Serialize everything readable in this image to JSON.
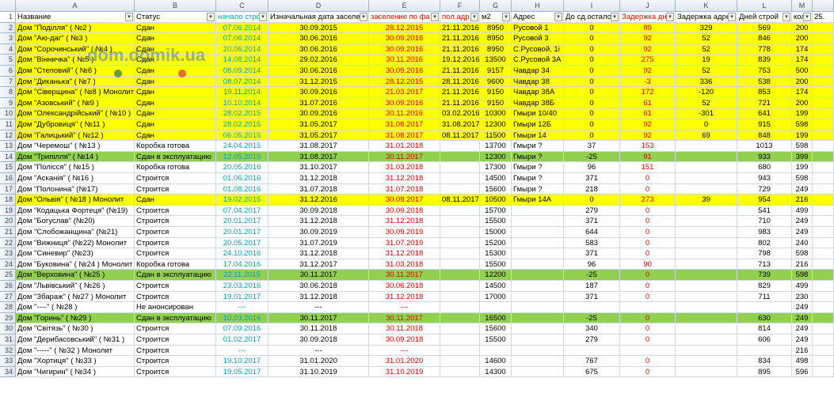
{
  "columns": [
    "A",
    "B",
    "C",
    "D",
    "E",
    "F",
    "G",
    "H",
    "I",
    "J",
    "K",
    "L",
    "M"
  ],
  "headers": {
    "rn": "1",
    "name": "Название",
    "status": "Статус",
    "start": "начало стро",
    "orig_date": "Изначальная дата заселе",
    "settle": "заселение по фа",
    "pol": "пол.адр",
    "m2": "м2",
    "addr": "Адрес",
    "left": "До сд.остало",
    "delay": "Задержка дн",
    "delay_addr": "Задержка адре",
    "days": "Дней строй",
    "kol": "кол",
    "extra": "25."
  },
  "watermark": "dom.domik.ua",
  "rows": [
    {
      "rn": "2",
      "name": "Дом \"Поділля\" ( №2 )",
      "status": "Сдан",
      "start": "07.06.2014",
      "orig": "30.09.2015",
      "settle": "28.12.2015",
      "pol": "21.11.2016",
      "m2": "8950",
      "addr": "Русовой 1",
      "left": "0",
      "delay": "89",
      "dadr": "329",
      "days": "569",
      "kol": "200",
      "style": "yellow"
    },
    {
      "rn": "3",
      "name": "Дом \"Аю-даг\" ( №3 )",
      "status": "Сдан",
      "start": "07.06.2014",
      "orig": "30.06.2016",
      "settle": "30.09.2016",
      "pol": "21.11.2016",
      "m2": "8950",
      "addr": "Русовой 3",
      "left": "0",
      "delay": "92",
      "dadr": "52",
      "days": "846",
      "kol": "200",
      "style": "yellow"
    },
    {
      "rn": "4",
      "name": "Дом \"Сорочинський\" ( №4 )",
      "status": "Сдан",
      "start": "20.06.2014",
      "orig": "30.06.2016",
      "settle": "30.09.2016",
      "pol": "21.11.2016",
      "m2": "8950",
      "addr": "С.Русовой, 1і",
      "left": "0",
      "delay": "92",
      "dadr": "52",
      "days": "778",
      "kol": "174",
      "style": "yellow"
    },
    {
      "rn": "5",
      "name": "Дом \"Вінничка\" ( №5 )",
      "status": "Сдан",
      "start": "14.08.2014",
      "orig": "29.02.2016",
      "settle": "30.11.2016",
      "pol": "19.12.2016",
      "m2": "13500",
      "addr": "С.Русовой 3А",
      "left": "0",
      "delay": "275",
      "dadr": "19",
      "days": "839",
      "kol": "174",
      "style": "yellow"
    },
    {
      "rn": "6",
      "name": "Дом \"Степовий\" ( №6 )",
      "status": "Сдан",
      "start": "08.09.2014",
      "orig": "30.06.2016",
      "settle": "30.09.2016",
      "pol": "21.11.2016",
      "m2": "9157",
      "addr": "Чавдар 34",
      "left": "0",
      "delay": "92",
      "dadr": "52",
      "days": "753",
      "kol": "500",
      "style": "yellow"
    },
    {
      "rn": "7",
      "name": "Дом \"Диканька\" ( №7 )",
      "status": "Сдан",
      "start": "08.07.2014",
      "orig": "31.12.2015",
      "settle": "28.12.2015",
      "pol": "28.11.2016",
      "m2": "9600",
      "addr": "Чавдар 38",
      "left": "0",
      "delay": "-3",
      "dadr": "336",
      "days": "538",
      "kol": "200",
      "style": "yellow"
    },
    {
      "rn": "8",
      "name": "Дом \"Сіверщина\" ( №8 ) Монолит",
      "status": "Сдан",
      "start": "19.11.2014",
      "orig": "30.09.2016",
      "settle": "21.03.2017",
      "pol": "21.11.2016",
      "m2": "9150",
      "addr": "Чавдар 38А",
      "left": "0",
      "delay": "172",
      "dadr": "-120",
      "days": "853",
      "kol": "174",
      "style": "yellow"
    },
    {
      "rn": "9",
      "name": "Дом \"Азовський\" ( №9 )",
      "status": "Сдан",
      "start": "10.10.2014",
      "orig": "31.07.2016",
      "settle": "30.09.2016",
      "pol": "21.11.2016",
      "m2": "9150",
      "addr": "Чавдар 38Б",
      "left": "0",
      "delay": "61",
      "dadr": "52",
      "days": "721",
      "kol": "200",
      "style": "yellow"
    },
    {
      "rn": "10",
      "name": "Дом \"Олександрійський\" ( №10 )",
      "status": "Сдан",
      "start": "28.02.2015",
      "orig": "30.09.2016",
      "settle": "30.11.2016",
      "pol": "03.02.2016",
      "m2": "10300",
      "addr": "Гмыри 10/40",
      "left": "0",
      "delay": "61",
      "dadr": "-301",
      "days": "641",
      "kol": "199",
      "style": "yellow"
    },
    {
      "rn": "11",
      "name": "Дом \"Дубровиця\" ( №11 )",
      "status": "Сдан",
      "start": "28.02.2015",
      "orig": "31.05.2017",
      "settle": "31.08.2017",
      "pol": "31.08.2017",
      "m2": "12300",
      "addr": "Гмыри 12Б",
      "left": "0",
      "delay": "92",
      "dadr": "0",
      "days": "915",
      "kol": "598",
      "style": "yellow"
    },
    {
      "rn": "12",
      "name": "Дом \"Галицький\" ( №12 )",
      "status": "Сдан",
      "start": "06.05.2015",
      "orig": "31.05.2017",
      "settle": "31.08.2017",
      "pol": "08.11.2017",
      "m2": "11500",
      "addr": "Гмыри 14",
      "left": "0",
      "delay": "92",
      "dadr": "69",
      "days": "848",
      "kol": "199",
      "style": "yellow"
    },
    {
      "rn": "13",
      "name": "Дом \"Черемош\" ( №13 )",
      "status": "Коробка готова",
      "start": "24.04.2015",
      "orig": "31.08.2017",
      "settle": "31.01.2018",
      "pol": "",
      "m2": "13700",
      "addr": "Гмыри ?",
      "left": "37",
      "delay": "153",
      "dadr": "",
      "days": "1013",
      "kol": "598",
      "style": ""
    },
    {
      "rn": "14",
      "name": "Дом \"Трипілля\" ( №14 )",
      "status": "Сдан в эксплуатацию",
      "start": "12.05.2015",
      "orig": "31.08.2017",
      "settle": "30.11.2017",
      "pol": "",
      "m2": "12300",
      "addr": "Гмыри ?",
      "left": "-25",
      "delay": "91",
      "dadr": "",
      "days": "933",
      "kol": "399",
      "style": "green"
    },
    {
      "rn": "15",
      "name": "Дом \"Полісся\" ( №15 )",
      "status": "Коробка готова",
      "start": "20.05.2016",
      "orig": "31.10.2017",
      "settle": "31.03.2018",
      "pol": "",
      "m2": "17300",
      "addr": "Гмыри ?",
      "left": "96",
      "delay": "151",
      "dadr": "",
      "days": "680",
      "kol": "199",
      "style": ""
    },
    {
      "rn": "16",
      "name": "Дом \"Асканія\" ( №16 )",
      "status": "Строится",
      "start": "01.06.2016",
      "orig": "31.12.2018",
      "settle": "31.12.2018",
      "pol": "",
      "m2": "14500",
      "addr": "Гмыри ?",
      "left": "371",
      "delay": "0",
      "dadr": "",
      "days": "943",
      "kol": "598",
      "style": ""
    },
    {
      "rn": "17",
      "name": "Дом \"Полонина\" (№17)",
      "status": "Строится",
      "start": "01.08.2016",
      "orig": "31.07.2018",
      "settle": "31.07.2018",
      "pol": "",
      "m2": "15600",
      "addr": "Гмыри ?",
      "left": "218",
      "delay": "0",
      "dadr": "",
      "days": "729",
      "kol": "249",
      "style": ""
    },
    {
      "rn": "18",
      "name": "Дом \"Ольвія\" ( №18 ) Монолит",
      "status": "Сдан",
      "start": "19.02.2015",
      "orig": "31.12.2016",
      "settle": "30.09.2017",
      "pol": "08.11.2017",
      "m2": "10500",
      "addr": "Гмыри 14А",
      "left": "0",
      "delay": "273",
      "dadr": "39",
      "days": "954",
      "kol": "216",
      "style": "yellow"
    },
    {
      "rn": "19",
      "name": "Дом \"Кодацька Фортеця\" (№19)",
      "status": "Строится",
      "start": "07.04.2017",
      "orig": "30.09.2018",
      "settle": "30.09.2018",
      "pol": "",
      "m2": "15700",
      "addr": "",
      "left": "279",
      "delay": "0",
      "dadr": "",
      "days": "541",
      "kol": "499",
      "style": ""
    },
    {
      "rn": "20",
      "name": "Дом \"Богуслав\" (№20)",
      "status": "Строится",
      "start": "20.01.2017",
      "orig": "31.12.2018",
      "settle": "31.12.2018",
      "pol": "",
      "m2": "15500",
      "addr": "",
      "left": "371",
      "delay": "0",
      "dadr": "",
      "days": "710",
      "kol": "249",
      "style": ""
    },
    {
      "rn": "21",
      "name": "Дом \"Слобожанщина\" (№21)",
      "status": "Строится",
      "start": "20.01.2017",
      "orig": "30.09.2019",
      "settle": "30.09.2019",
      "pol": "",
      "m2": "15000",
      "addr": "",
      "left": "644",
      "delay": "0",
      "dadr": "",
      "days": "983",
      "kol": "249",
      "style": ""
    },
    {
      "rn": "22",
      "name": "Дом \"Вижниця\" (№22) Монолит",
      "status": "Строится",
      "start": "20.05.2017",
      "orig": "31.07.2019",
      "settle": "31.07.2019",
      "pol": "",
      "m2": "15200",
      "addr": "",
      "left": "583",
      "delay": "0",
      "dadr": "",
      "days": "802",
      "kol": "240",
      "style": ""
    },
    {
      "rn": "23",
      "name": "Дом \"Синевир\" (№23)",
      "status": "Строится",
      "start": "24.10.2016",
      "orig": "31.12.2018",
      "settle": "31.12.2018",
      "pol": "",
      "m2": "15300",
      "addr": "",
      "left": "371",
      "delay": "0",
      "dadr": "",
      "days": "798",
      "kol": "598",
      "style": ""
    },
    {
      "rn": "24",
      "name": "Дом \"Буковина\" ( №24 ) Монолит",
      "status": "Коробка готова",
      "start": "17.04.2016",
      "orig": "31.12.2017",
      "settle": "31.03.2018",
      "pol": "",
      "m2": "15500",
      "addr": "",
      "left": "96",
      "delay": "90",
      "dadr": "",
      "days": "713",
      "kol": "216",
      "style": ""
    },
    {
      "rn": "25",
      "name": "Дом \"Верховина\" ( №25 )",
      "status": "Сдан в эксплуатацию",
      "start": "22.11.2015",
      "orig": "30.11.2017",
      "settle": "30.11.2017",
      "pol": "",
      "m2": "12200",
      "addr": "",
      "left": "-25",
      "delay": "0",
      "dadr": "",
      "days": "739",
      "kol": "598",
      "style": "green"
    },
    {
      "rn": "26",
      "name": "Дом \"Львівський\" ( №26 )",
      "status": "Строится",
      "start": "23.03.2016",
      "orig": "30.06.2018",
      "settle": "30.06.2018",
      "pol": "",
      "m2": "14500",
      "addr": "",
      "left": "187",
      "delay": "0",
      "dadr": "",
      "days": "829",
      "kol": "499",
      "style": ""
    },
    {
      "rn": "27",
      "name": "Дом \"Збараж\" ( №27 ) Монолит",
      "status": "Строится",
      "start": "19.01.2017",
      "orig": "31.12.2018",
      "settle": "31.12.2018",
      "pol": "",
      "m2": "17000",
      "addr": "",
      "left": "371",
      "delay": "0",
      "dadr": "",
      "days": "711",
      "kol": "230",
      "style": ""
    },
    {
      "rn": "28",
      "name": "Дом \"----\" ( №28 )",
      "status": "Не анонсирован",
      "start": "---",
      "orig": "---",
      "settle": "---",
      "pol": "",
      "m2": "",
      "addr": "",
      "left": "",
      "delay": "",
      "dadr": "",
      "days": "",
      "kol": "249",
      "style": ""
    },
    {
      "rn": "29",
      "name": "Дом \"Горинь\" ( №29 )",
      "status": "Сдан в эксплуатацию",
      "start": "10.03.2016",
      "orig": "30.11.2017",
      "settle": "30.11.2017",
      "pol": "",
      "m2": "16500",
      "addr": "",
      "left": "-25",
      "delay": "0",
      "dadr": "",
      "days": "630",
      "kol": "249",
      "style": "green"
    },
    {
      "rn": "30",
      "name": "Дом \"Світязь\" ( №30 )",
      "status": "Строится",
      "start": "07.09.2016",
      "orig": "30.11.2018",
      "settle": "30.11.2018",
      "pol": "",
      "m2": "15600",
      "addr": "",
      "left": "340",
      "delay": "0",
      "dadr": "",
      "days": "814",
      "kol": "249",
      "style": ""
    },
    {
      "rn": "31",
      "name": "Дом \"Дерибасовський\" ( №31 )",
      "status": "Строится",
      "start": "01.02.2017",
      "orig": "30.09.2018",
      "settle": "30.09.2018",
      "pol": "",
      "m2": "15500",
      "addr": "",
      "left": "279",
      "delay": "0",
      "dadr": "",
      "days": "606",
      "kol": "249",
      "style": ""
    },
    {
      "rn": "32",
      "name": "Дом \"-----\" ( №32 ) Монолит",
      "status": "Строится",
      "start": "---",
      "orig": "---",
      "settle": "---",
      "pol": "",
      "m2": "",
      "addr": "",
      "left": "",
      "delay": "",
      "dadr": "",
      "days": "",
      "kol": "216",
      "style": ""
    },
    {
      "rn": "33",
      "name": "Дом \"Хортиця\" ( №33 )",
      "status": "Строится",
      "start": "19.10.2017",
      "orig": "31.01.2020",
      "settle": "31.01.2020",
      "pol": "",
      "m2": "14600",
      "addr": "",
      "left": "767",
      "delay": "0",
      "dadr": "",
      "days": "834",
      "kol": "498",
      "style": ""
    },
    {
      "rn": "34",
      "name": "Дом \"Чигирин\" ( №34 )",
      "status": "Строится",
      "start": "19.05.2017",
      "orig": "31.10.2019",
      "settle": "31.10.2019",
      "pol": "",
      "m2": "14300",
      "addr": "",
      "left": "675",
      "delay": "0",
      "dadr": "",
      "days": "895",
      "kol": "596",
      "style": ""
    }
  ]
}
